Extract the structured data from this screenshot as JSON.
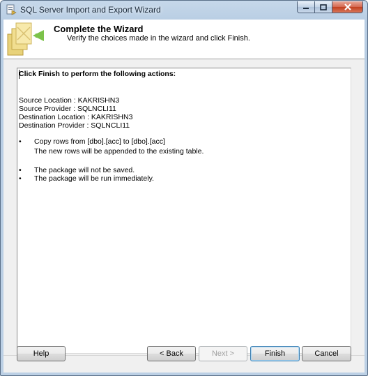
{
  "window": {
    "title": "SQL Server Import and Export Wizard"
  },
  "header": {
    "title": "Complete the Wizard",
    "subtitle": "Verify the choices made in the wizard and click Finish."
  },
  "content": {
    "lead": "Click Finish to perform the following actions:",
    "info": [
      "Source Location : KAKRISHN3",
      "Source Provider : SQLNCLI11",
      "Destination Location : KAKRISHN3",
      "Destination Provider : SQLNCLI11"
    ],
    "bullet_char": "•",
    "actions": [
      "Copy rows from [dbo].[acc] to [dbo].[acc]",
      "The new rows will be appended to the existing table.",
      "The package will not be saved.",
      "The package will be run immediately."
    ]
  },
  "buttons": {
    "help": "Help",
    "back": "< Back",
    "next": "Next >",
    "finish": "Finish",
    "cancel": "Cancel"
  },
  "colors": {
    "title_bar": "#bcd0e5",
    "close_button": "#c2401f",
    "dialog_bg": "#f0f0f0"
  }
}
